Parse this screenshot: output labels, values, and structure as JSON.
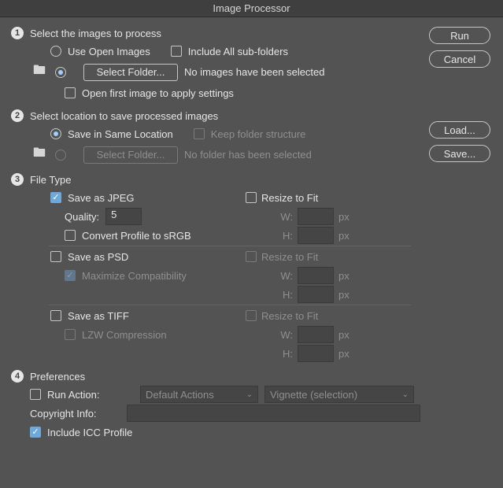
{
  "title": "Image Processor",
  "side": {
    "run": "Run",
    "cancel": "Cancel",
    "load": "Load...",
    "save": "Save..."
  },
  "s1": {
    "num": "1",
    "heading": "Select the images to process",
    "useOpen": "Use Open Images",
    "includeSub": "Include All sub-folders",
    "selectFolder": "Select Folder...",
    "noImages": "No images have been selected",
    "openFirst": "Open first image to apply settings"
  },
  "s2": {
    "num": "2",
    "heading": "Select location to save processed images",
    "sameLoc": "Save in Same Location",
    "keepStruct": "Keep folder structure",
    "selectFolder": "Select Folder...",
    "noFolder": "No folder has been selected"
  },
  "s3": {
    "num": "3",
    "heading": "File Type",
    "jpeg": "Save as JPEG",
    "resize": "Resize to Fit",
    "qualityLbl": "Quality:",
    "qualityVal": "5",
    "w": "W:",
    "h": "H:",
    "px": "px",
    "srgb": "Convert Profile to sRGB",
    "psd": "Save as PSD",
    "maxComp": "Maximize Compatibility",
    "tiff": "Save as TIFF",
    "lzw": "LZW Compression"
  },
  "s4": {
    "num": "4",
    "heading": "Preferences",
    "runAction": "Run Action:",
    "actionSet": "Default Actions",
    "action": "Vignette (selection)",
    "copyright": "Copyright Info:",
    "icc": "Include ICC Profile"
  }
}
